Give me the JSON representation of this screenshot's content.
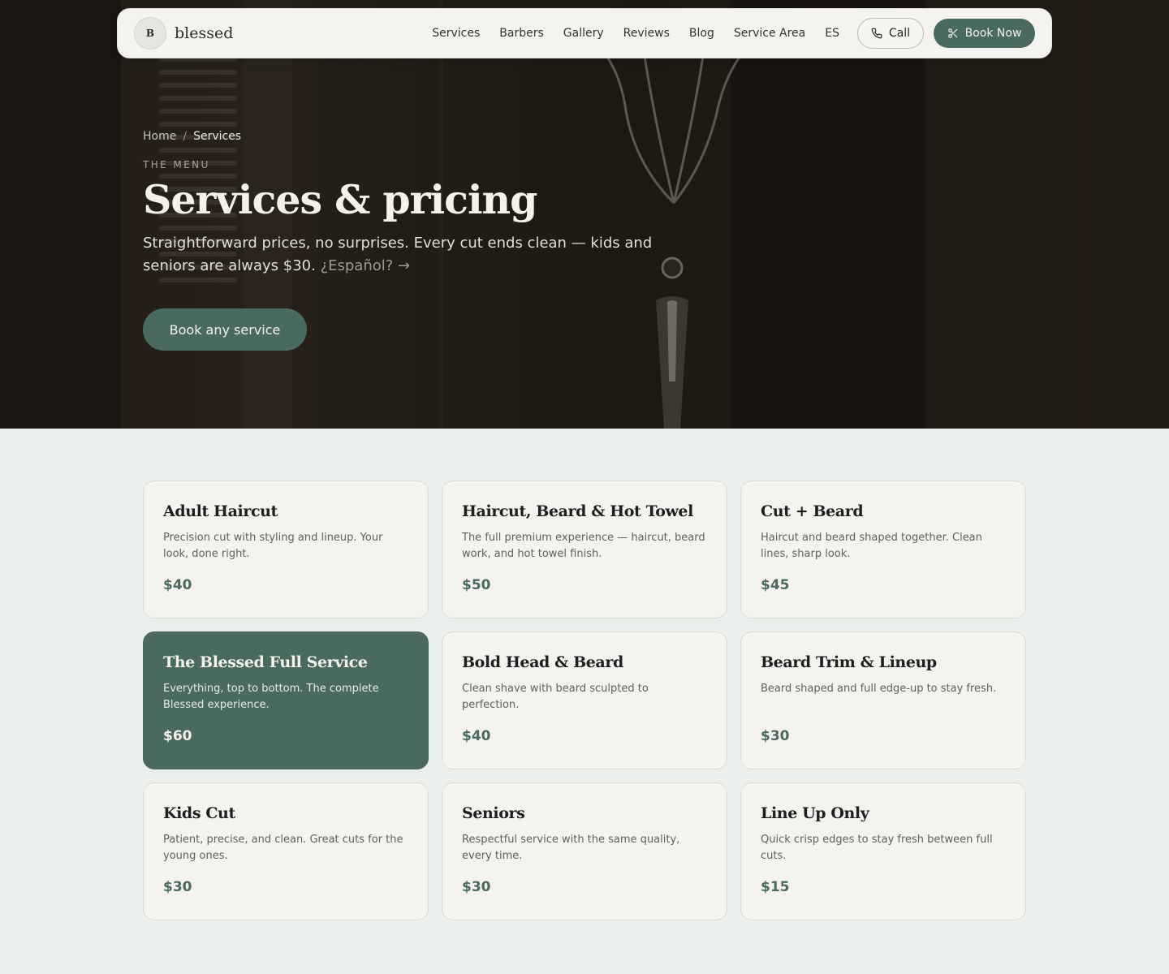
{
  "nav": {
    "logo_mark": "B",
    "logo_text": "blessed",
    "links": [
      "Services",
      "Barbers",
      "Gallery",
      "Reviews",
      "Blog",
      "Service Area",
      "ES"
    ],
    "call_label": "Call",
    "book_label": "Book Now"
  },
  "hero": {
    "breadcrumb_home": "Home",
    "breadcrumb_sep": "/",
    "breadcrumb_current": "Services",
    "eyebrow": "THE MENU",
    "title": "Services & pricing",
    "text": "Straightforward prices, no surprises. Every cut ends clean — kids and seniors are always $30.",
    "spanish_link": "¿Español? →",
    "cta_label": "Book any service"
  },
  "services": [
    {
      "title": "Adult Haircut",
      "desc": "Precision cut with styling and lineup. Your look, done right.",
      "price": "$40"
    },
    {
      "title": "Haircut, Beard & Hot Towel",
      "desc": "The full premium experience — haircut, beard work, and hot towel finish.",
      "price": "$50"
    },
    {
      "title": "Cut + Beard",
      "desc": "Haircut and beard shaped together. Clean lines, sharp look.",
      "price": "$45"
    },
    {
      "title": "The Blessed Full Service",
      "desc": "Everything, top to bottom. The complete Blessed experience.",
      "price": "$60"
    },
    {
      "title": "Bold Head & Beard",
      "desc": "Clean shave with beard sculpted to perfection.",
      "price": "$40"
    },
    {
      "title": "Beard Trim & Lineup",
      "desc": "Beard shaped and full edge-up to stay fresh.",
      "price": "$30"
    },
    {
      "title": "Kids Cut",
      "desc": "Patient, precise, and clean. Great cuts for the young ones.",
      "price": "$30"
    },
    {
      "title": "Seniors",
      "desc": "Respectful service with the same quality, every time.",
      "price": "$30"
    },
    {
      "title": "Line Up Only",
      "desc": "Quick crisp edges to stay fresh between full cuts.",
      "price": "$15"
    }
  ],
  "colors": {
    "accent": "#4a6a5f",
    "page_bg": "#eaefec",
    "card_bg": "#f4f3ef",
    "hero_bg": "#1f1a15"
  },
  "icons": {
    "call": "phone-icon",
    "book": "scissors-icon"
  }
}
